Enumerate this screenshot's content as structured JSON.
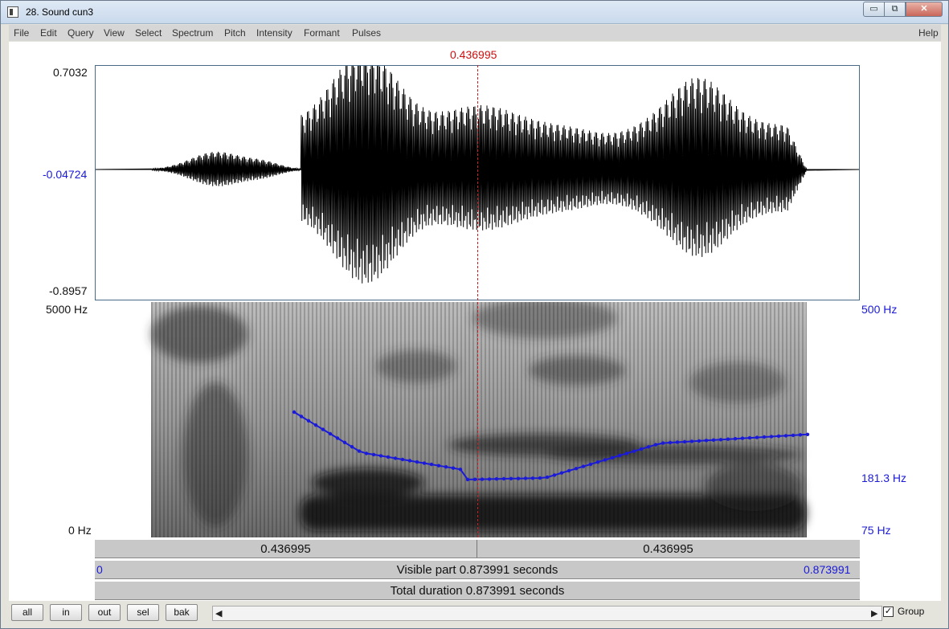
{
  "window": {
    "title": "28. Sound cun3",
    "buttons": {
      "minimize": "▭",
      "maximize": "⧉",
      "close": "✕"
    }
  },
  "menu": [
    "File",
    "Edit",
    "Query",
    "View",
    "Select",
    "Spectrum",
    "Pitch",
    "Intensity",
    "Formant",
    "Pulses"
  ],
  "help_label": "Help",
  "cursor_time": "0.436995",
  "waveform": {
    "max": "0.7032",
    "mid": "-0.04724",
    "min": "-0.8957"
  },
  "spectrogram": {
    "top": "5000 Hz",
    "bottom": "0 Hz"
  },
  "pitch": {
    "top": "500 Hz",
    "cursor": "181.3 Hz",
    "bottom": "75 Hz"
  },
  "time_bar": {
    "left": "0.436995",
    "right": "0.436995"
  },
  "visible_bar": {
    "start": "0",
    "text": "Visible part 0.873991 seconds",
    "end": "0.873991"
  },
  "total_bar": {
    "text": "Total duration 0.873991 seconds"
  },
  "buttons": {
    "all": "all",
    "in": "in",
    "out": "out",
    "sel": "sel",
    "bak": "bak"
  },
  "group": {
    "label": "Group",
    "checked": true
  },
  "colors": {
    "cursor": "#cc1010",
    "pitch_line": "#1a1ad8",
    "axis_blue": "#1a1ad8"
  }
}
